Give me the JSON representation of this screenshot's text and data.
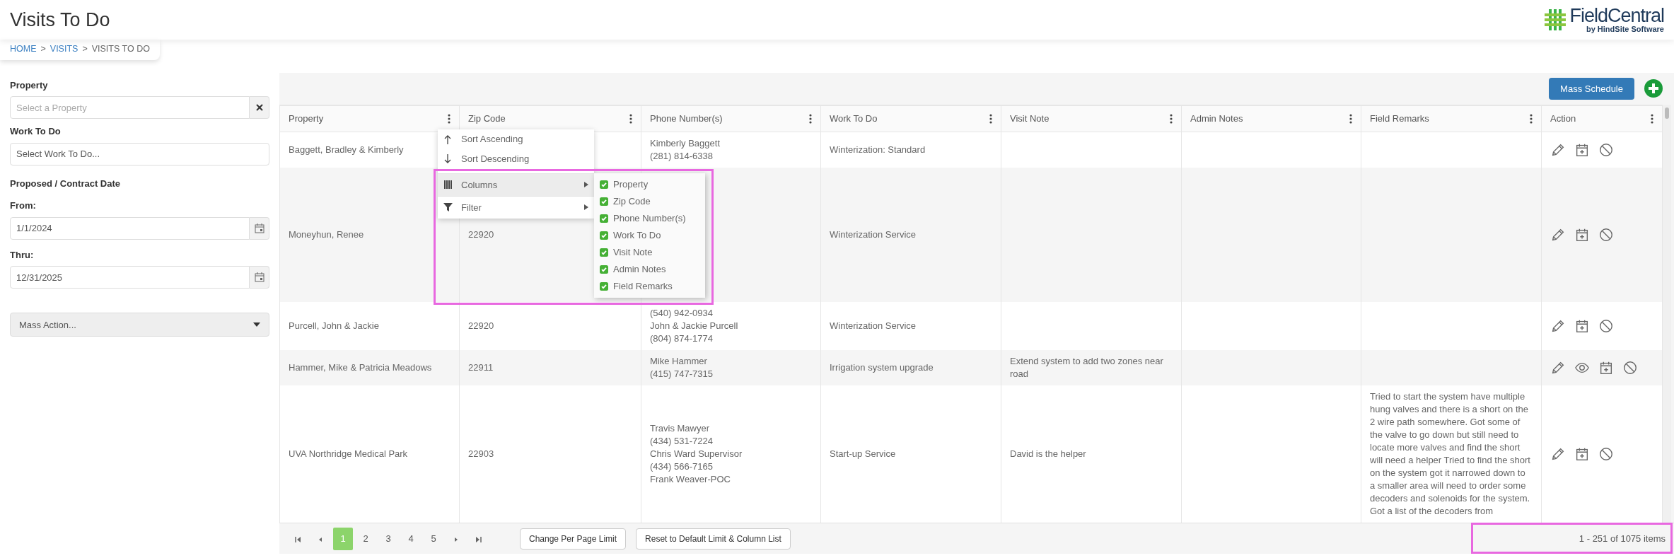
{
  "header": {
    "title": "Visits To Do",
    "logo": {
      "name": "FieldCentral",
      "tagline": "by HindSite Software"
    }
  },
  "breadcrumb": [
    {
      "kind": "link",
      "label": "HOME"
    },
    {
      "kind": "separator",
      "label": ">"
    },
    {
      "kind": "link",
      "label": "VISITS"
    },
    {
      "kind": "separator",
      "label": ">"
    },
    {
      "kind": "current",
      "label": "VISITS TO DO"
    }
  ],
  "sidebar": {
    "fields": [
      {
        "kind": "clearable",
        "label": "Property",
        "placeholder": "Select a Property"
      },
      {
        "kind": "select",
        "label": "Work To Do",
        "value": "Select Work To Do..."
      },
      {
        "kind": "heading",
        "label": "Proposed / Contract Date"
      },
      {
        "kind": "date",
        "label": "From:",
        "value": "1/1/2024"
      },
      {
        "kind": "date",
        "label": "Thru:",
        "value": "12/31/2025"
      },
      {
        "kind": "dropdown",
        "value": "Mass Action..."
      }
    ]
  },
  "toolbar": {
    "button": "Mass Schedule"
  },
  "table": {
    "columns": [
      "Property",
      "Zip Code",
      "Phone Number(s)",
      "Work To Do",
      "Visit Note",
      "Admin Notes",
      "Field Remarks",
      "Action"
    ],
    "rows": [
      {
        "property": "Baggett, Bradley & Kimberly",
        "zip": "",
        "phones": [
          "Kimberly Baggett",
          "(281) 814-6338"
        ],
        "work": "Winterization: Standard",
        "visit_note": "",
        "admin_notes": "",
        "field_remarks": "",
        "actions": [
          {
            "kind": "edit"
          },
          {
            "kind": "schedule"
          },
          {
            "kind": "cancel"
          }
        ]
      },
      {
        "property": "Moneyhun, Renee",
        "zip": "22920",
        "phones": [],
        "work": "Winterization Service",
        "visit_note": "",
        "admin_notes": "",
        "field_remarks": "",
        "actions": [
          {
            "kind": "edit"
          },
          {
            "kind": "schedule"
          },
          {
            "kind": "cancel"
          }
        ]
      },
      {
        "property": "Purcell, John & Jackie",
        "zip": "22920",
        "phones": [
          "(540) 942-0934",
          "John & Jackie Purcell",
          "(804) 874-1774"
        ],
        "work": "Winterization Service",
        "visit_note": "",
        "admin_notes": "",
        "field_remarks": "",
        "actions": [
          {
            "kind": "edit"
          },
          {
            "kind": "schedule"
          },
          {
            "kind": "cancel"
          }
        ]
      },
      {
        "property": "Hammer, Mike & Patricia Meadows",
        "zip": "22911",
        "phones": [
          "Mike Hammer",
          "(415) 747-7315"
        ],
        "work": "Irrigation system upgrade",
        "visit_note": "Extend system to add two zones near road",
        "admin_notes": "",
        "field_remarks": "",
        "actions": [
          {
            "kind": "edit"
          },
          {
            "kind": "view"
          },
          {
            "kind": "schedule"
          },
          {
            "kind": "cancel"
          }
        ]
      },
      {
        "property": "UVA Northridge Medical Park",
        "zip": "22903",
        "phones": [
          "Travis Mawyer",
          "(434) 531-7224",
          "Chris Ward Supervisor",
          "(434) 566-7165",
          "Frank Weaver-POC"
        ],
        "work": "Start-up Service",
        "visit_note": "David is the helper",
        "admin_notes": "",
        "field_remarks": "Tried to start the system have multiple hung valves and there is a short on the 2 wire path somewhere. Got some of the valve to go down but still need to locate more valves and find the short will need a helper Tried to find the short on the system got it narrowed down to a smaller area will need to order some decoders and solenoids for the system. Got a list of the decoders from",
        "actions": [
          {
            "kind": "edit"
          },
          {
            "kind": "schedule"
          },
          {
            "kind": "cancel"
          }
        ]
      }
    ]
  },
  "column_menu": {
    "items": [
      {
        "kind": "sort-asc",
        "label": "Sort Ascending",
        "submenu": false,
        "selected": false
      },
      {
        "kind": "sort-desc",
        "label": "Sort Descending",
        "submenu": false,
        "selected": false
      },
      {
        "kind": "columns",
        "label": "Columns",
        "submenu": true,
        "selected": true
      },
      {
        "kind": "filter",
        "label": "Filter",
        "submenu": true,
        "selected": false
      }
    ],
    "columns_submenu": [
      {
        "label": "Property",
        "checked": true
      },
      {
        "label": "Zip Code",
        "checked": true
      },
      {
        "label": "Phone Number(s)",
        "checked": true
      },
      {
        "label": "Work To Do",
        "checked": true
      },
      {
        "label": "Visit Note",
        "checked": true
      },
      {
        "label": "Admin Notes",
        "checked": true
      },
      {
        "label": "Field Remarks",
        "checked": true
      }
    ]
  },
  "pager": {
    "pages": [
      {
        "label": "1",
        "selected": true
      },
      {
        "label": "2",
        "selected": false
      },
      {
        "label": "3",
        "selected": false
      },
      {
        "label": "4",
        "selected": false
      },
      {
        "label": "5",
        "selected": false
      }
    ],
    "buttons": [
      "Change Per Page Limit",
      "Reset to Default Limit & Column List"
    ],
    "summary": "1 - 251 of 1075 items"
  }
}
